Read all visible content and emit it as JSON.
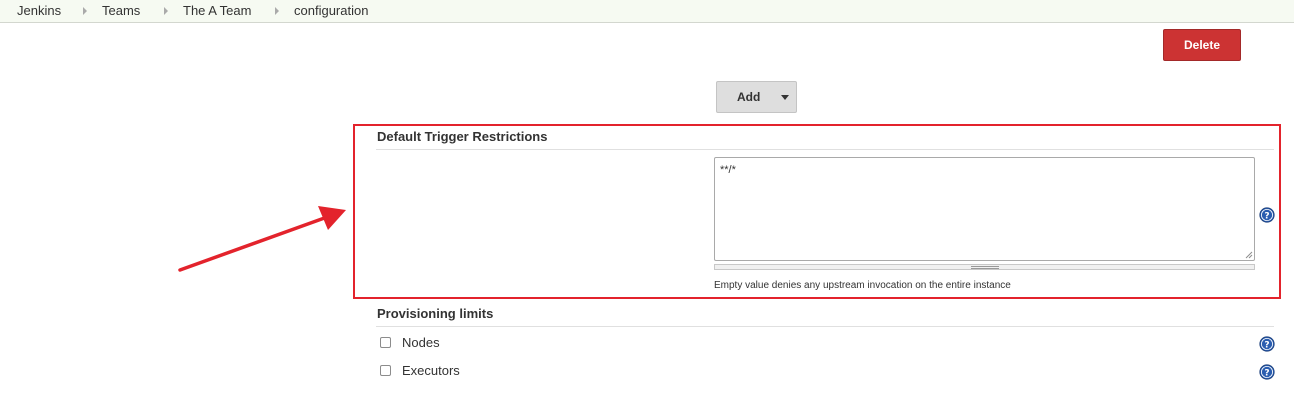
{
  "breadcrumb": {
    "items": [
      "Jenkins",
      "Teams",
      "The A Team",
      "configuration"
    ]
  },
  "toolbar": {
    "delete_label": "Delete",
    "add_label": "Add"
  },
  "trigger_restrictions": {
    "title": "Default Trigger Restrictions",
    "value": "**/*",
    "hint": "Empty value denies any upstream invocation on the entire instance"
  },
  "provisioning_limits": {
    "title": "Provisioning limits",
    "options": [
      {
        "label": "Nodes",
        "checked": false
      },
      {
        "label": "Executors",
        "checked": false
      }
    ]
  },
  "colors": {
    "delete_button": "#cc3333",
    "highlight_box": "#e3232c",
    "annotation_arrow": "#e3232c",
    "help_icon": "#2a5db0",
    "breadcrumb_bar": "#f6faf2"
  },
  "icons": {
    "help": "help-icon",
    "breadcrumb_separator": "chevron-right-icon",
    "dropdown": "chevron-down-icon",
    "annotation": "red-arrow-icon"
  }
}
